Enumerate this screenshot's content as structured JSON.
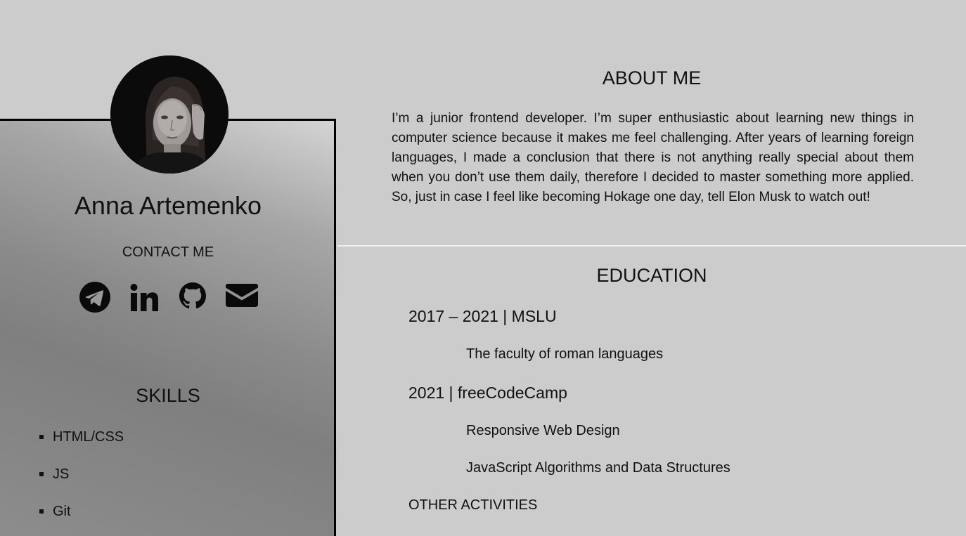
{
  "profile": {
    "name": "Anna Artemenko",
    "contact_title": "CONTACT ME",
    "contacts": [
      {
        "icon": "telegram-icon"
      },
      {
        "icon": "linkedin-icon"
      },
      {
        "icon": "github-icon"
      },
      {
        "icon": "email-icon"
      }
    ]
  },
  "skills": {
    "title": "SKILLS",
    "items": [
      "HTML/CSS",
      "JS",
      "Git"
    ]
  },
  "about": {
    "title": "ABOUT ME",
    "text": "I’m a junior frontend developer. I’m super enthusiastic about learning new things in computer science because it makes me feel challenging. After years of learning foreign languages, I made a conclusion that there is not anything really special about them when you don’t use them daily, therefore I decided to master something more applied. So, just in case I feel like becoming Hokage one day, tell Elon Musk to watch out!"
  },
  "education": {
    "title": "EDUCATION",
    "entries": [
      {
        "heading": "2017 – 2021 | MSLU",
        "items": [
          "The faculty of roman languages"
        ]
      },
      {
        "heading": "2021 | freeCodeCamp",
        "items": [
          "Responsive Web Design",
          "JavaScript Algorithms and Data Structures"
        ]
      }
    ],
    "other_title": "OTHER ACTIVITIES"
  },
  "colors": {
    "background": "#cccccc",
    "sidebar_light": "#d4d4d4",
    "sidebar_dark": "#7f7f7f",
    "text": "#111111"
  }
}
